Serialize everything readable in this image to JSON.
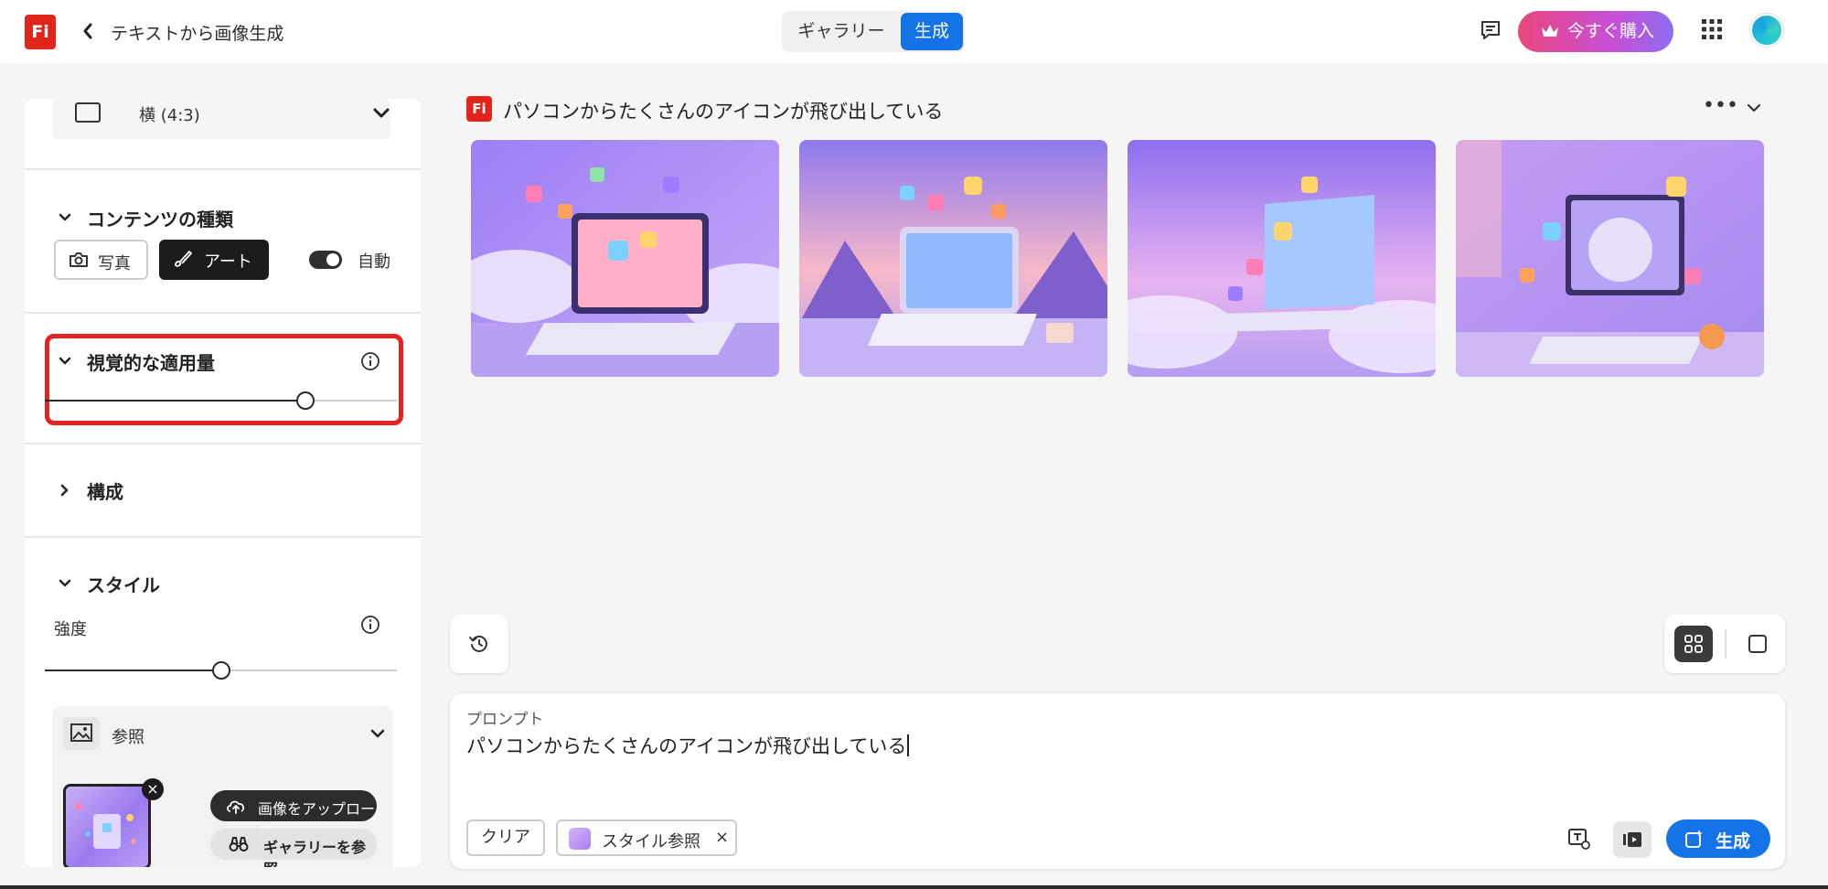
{
  "header": {
    "app_logo_text": "Fi",
    "back_icon": "chevron-left-icon",
    "title": "テキストから画像生成",
    "mode_tabs": [
      {
        "label": "ギャラリー",
        "active": false
      },
      {
        "label": "生成",
        "active": true
      }
    ],
    "feedback_icon": "feedback-icon",
    "buy_label": "今すぐ購入",
    "buy_icon": "crown-icon",
    "apps_icon": "apps-grid-icon",
    "accent_color": "#1473e6"
  },
  "left_panel": {
    "aspect_ratio": {
      "label": "横 (4:3)",
      "icon": "landscape-icon"
    },
    "content_type": {
      "heading": "コンテンツの種類",
      "photo_label": "写真",
      "art_label": "アート",
      "auto_label": "自動",
      "selected": "アート",
      "auto_enabled": true
    },
    "visual_intensity": {
      "heading": "視覚的な適用量",
      "slider_value_fraction": 0.74,
      "highlight_color": "#e32222"
    },
    "composition": {
      "heading": "構成",
      "expanded": false
    },
    "style": {
      "heading": "スタイル",
      "strength_label": "強度",
      "strength_value_fraction": 0.5,
      "reference": {
        "label": "参照",
        "upload_label": "画像をアップロード",
        "gallery_label": "ギャラリーを参照"
      }
    }
  },
  "main": {
    "result": {
      "logo_text": "Fi",
      "prompt_title": "パソコンからたくさんのアイコンが飛び出している",
      "more_icon": "more-horizontal-icon",
      "images": [
        {
          "name": "generated-image-1"
        },
        {
          "name": "generated-image-2"
        },
        {
          "name": "generated-image-3"
        },
        {
          "name": "generated-image-4"
        }
      ]
    },
    "history_icon": "history-icon",
    "view_modes": [
      "grid-view-icon",
      "single-view-icon"
    ],
    "prompt": {
      "label": "プロンプト",
      "text": "パソコンからたくさんのアイコンが飛び出している",
      "clear_label": "クリア",
      "style_chip_label": "スタイル参照",
      "style_chip_remove": "×",
      "generate_label": "生成"
    }
  }
}
